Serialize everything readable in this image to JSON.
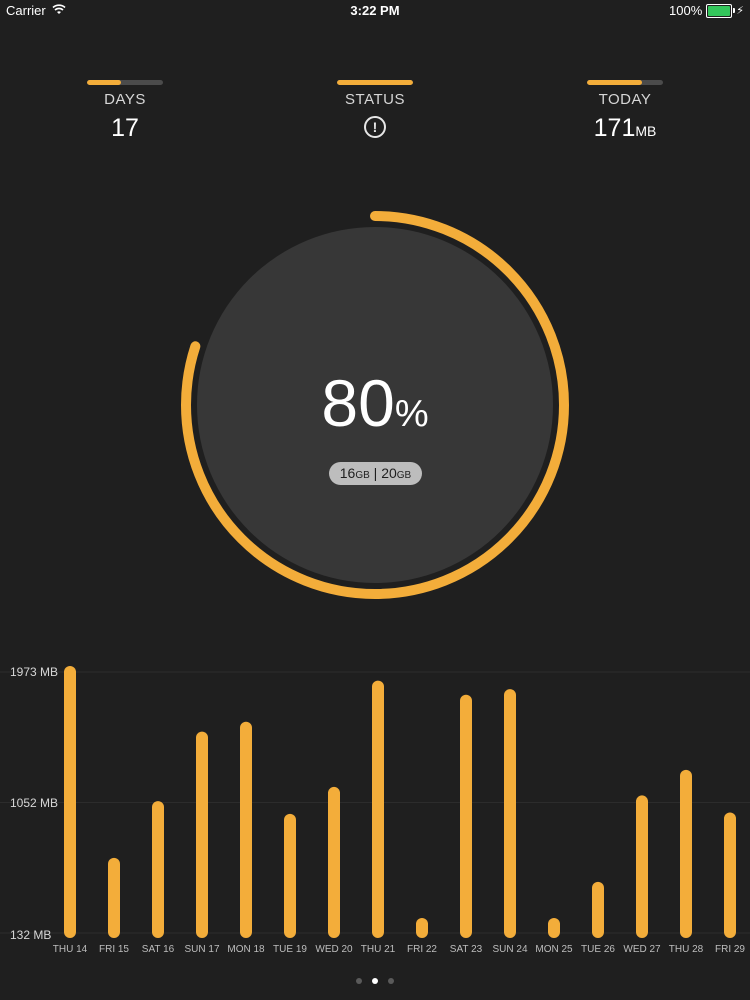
{
  "status_bar": {
    "carrier": "Carrier",
    "time": "3:22 PM",
    "battery": "100%"
  },
  "stats": {
    "days": {
      "label": "DAYS",
      "value": "17",
      "level": 0.45
    },
    "status": {
      "label": "STATUS",
      "icon": "exclamation-circle-icon",
      "level": 1.0
    },
    "today": {
      "label": "TODAY",
      "value": "171",
      "unit": "MB",
      "level": 0.72
    }
  },
  "gauge": {
    "percent": "80",
    "percent_sign": "%",
    "used": "16",
    "used_unit": "GB",
    "separator": "|",
    "total": "20",
    "total_unit": "GB",
    "progress": 0.8
  },
  "chart_data": {
    "type": "bar",
    "categories": [
      "THU 14",
      "FRI 15",
      "SAT 16",
      "SUN 17",
      "MON 18",
      "TUE 19",
      "WED 20",
      "THU 21",
      "FRI 22",
      "SAT 23",
      "SUN 24",
      "MON 25",
      "TUE 26",
      "WED 27",
      "THU 28",
      "FRI 29"
    ],
    "values": [
      1973,
      620,
      1020,
      1510,
      1580,
      930,
      1120,
      1870,
      170,
      1770,
      1810,
      140,
      450,
      1060,
      1240,
      940
    ],
    "y_ticks": [
      "1973 MB",
      "1052  MB",
      "132 MB"
    ],
    "ylim": [
      132,
      1973
    ],
    "color": "#f3ad3a"
  },
  "pages": {
    "count": 3,
    "active": 1
  },
  "colors": {
    "accent": "#f3ad3a",
    "background": "#1f1f1f",
    "disc": "#373737"
  }
}
